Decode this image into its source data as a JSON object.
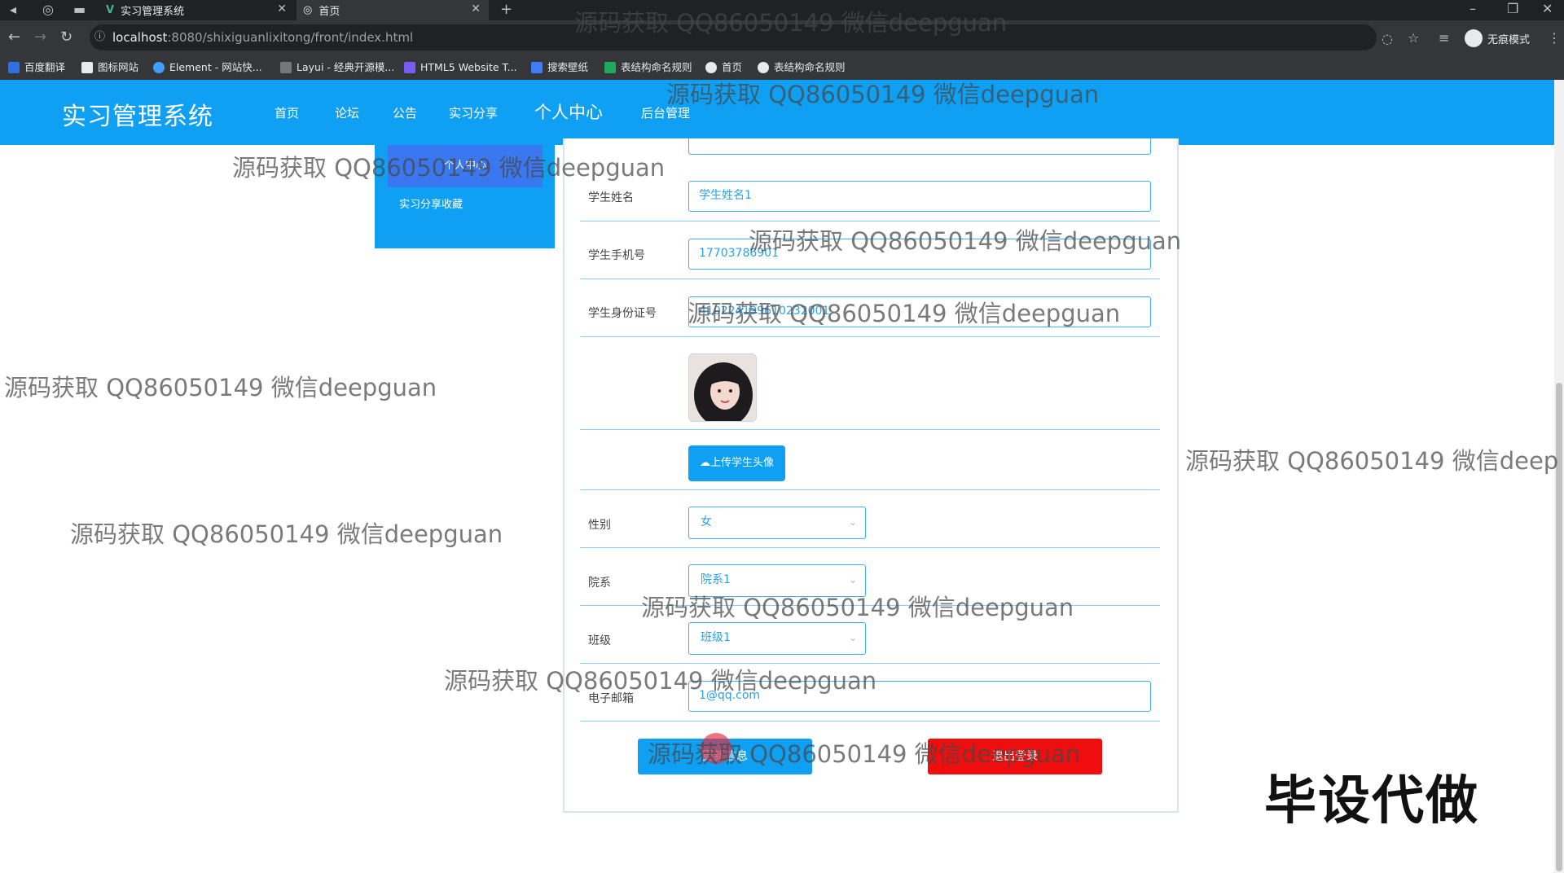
{
  "browser": {
    "tabs": [
      {
        "title": "实习管理系统"
      },
      {
        "title": "首页"
      }
    ],
    "url_host": "localhost",
    "url_rest": ":8080/shixiguanlixitong/front/index.html",
    "incognito_label": "无痕模式",
    "bookmarks": [
      "百度翻译",
      "图标网站",
      "Element - 网站快...",
      "Layui - 经典开源模...",
      "HTML5 Website T...",
      "搜索壁纸",
      "表结构命名规则",
      "首页",
      "表结构命名规则"
    ]
  },
  "app": {
    "brand": "实习管理系统",
    "nav": [
      "首页",
      "论坛",
      "公告",
      "实习分享",
      "个人中心",
      "后台管理"
    ]
  },
  "sidebar": {
    "active": "个人中心",
    "items": [
      "实习分享收藏"
    ]
  },
  "form": {
    "name_label": "学生姓名",
    "name_value": "学生姓名1",
    "phone_label": "学生手机号",
    "phone_value": "17703786901",
    "idcard_label": "学生身份证号",
    "idcard_value": "410224199610232001",
    "upload_label": "上传学生头像",
    "gender_label": "性别",
    "gender_value": "女",
    "dept_label": "院系",
    "dept_value": "院系1",
    "class_label": "班级",
    "class_value": "班级1",
    "email_label": "电子邮箱",
    "email_value": "1@qq.com",
    "update_button": "更新信息",
    "logout_button": "退出登录"
  },
  "watermark": "源码获取 QQ86050149 微信deepguan",
  "watermark_cut": "源码获取 QQ86050149 微信deep",
  "stamp": "毕设代做",
  "colors": {
    "primary": "#0fa0f4",
    "danger": "#f00d0d",
    "sidebar_active": "#3a78f2"
  }
}
